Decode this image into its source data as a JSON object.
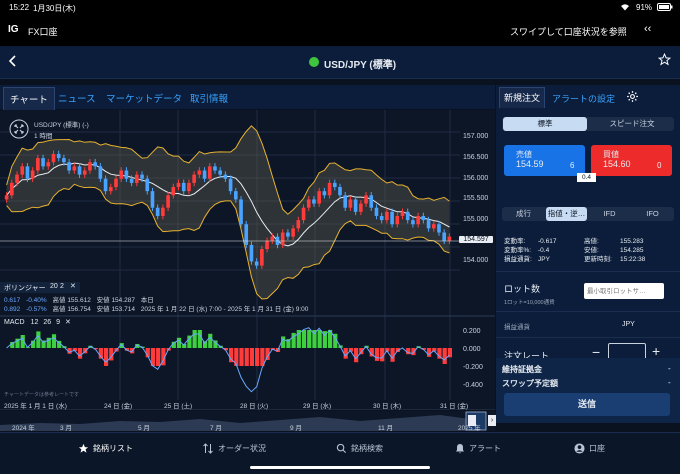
{
  "status": {
    "time": "15:22",
    "date": "1月30日(木)",
    "battery": "91%"
  },
  "header": {
    "logo": "IG",
    "account": "FX口座",
    "swipe_hint": "スワイプして口座状況を参照",
    "chevrons": "‹‹"
  },
  "pair": {
    "name": "USD/JPY (標準)",
    "dot_color": "#3ec43e"
  },
  "tabs": [
    "チャート",
    "ニュース",
    "マーケットデータ",
    "取引情報"
  ],
  "chart": {
    "symbol": "USD/JPY (標準) (-)",
    "timeframe": "1 時間",
    "current_price": "154.597",
    "y_ticks": [
      "157.000",
      "156.500",
      "156.000",
      "155.500",
      "155.000",
      "154.500",
      "154.000"
    ],
    "bollinger": {
      "label": "ボリンジャー",
      "period": "20",
      "dev": "2",
      "row1": {
        "c1": "0.617",
        "c2": "-0.40%",
        "c3": "高値 155.612",
        "c4": "安値 154.287",
        "c5": "本日"
      },
      "row2": {
        "c1": "0.892",
        "c2": "-0.57%",
        "c3": "高値 156.754",
        "c4": "安値 153.714",
        "c5": "2025 年 1 月 22 日 (水) 7:00 - 2025 年 1 月 31 日 (金) 9:00"
      }
    },
    "macd": {
      "label": "MACD",
      "p1": "12",
      "p2": "26",
      "p3": "9"
    },
    "macd_ticks": [
      "0.200",
      "0.000",
      "-0.200",
      "-0.400"
    ],
    "chart_note": "チャートデータは参考レートです",
    "date_label": "2025 年 1 月 1 日 (水)",
    "x_labels": [
      "24 日 (金)",
      "25 日 (土)",
      "28 日 (火)",
      "29 日 (水)",
      "30 日 (木)",
      "31 日 (金)"
    ],
    "overview_labels": [
      "2024 年",
      "3 月",
      "5 月",
      "7 月",
      "9 月",
      "11 月",
      "2025 年"
    ]
  },
  "order": {
    "tabs": [
      "新規注文",
      "アラートの設定"
    ],
    "modes": [
      "標準",
      "スピード注文"
    ],
    "sell_label": "売値",
    "sell_price_main": "154.59",
    "sell_price_small": "6",
    "buy_label": "買値",
    "buy_price_main": "154.60",
    "buy_price_small": "0",
    "spread": "0.4",
    "order_types": [
      "成行",
      "指値・逆…",
      "IFD",
      "IFO"
    ],
    "stats": [
      {
        "k": "変動率:",
        "v": "-0.617",
        "k2": "高値:",
        "v2": "155.283"
      },
      {
        "k": "変動率%:",
        "v": "-0.4",
        "k2": "安値:",
        "v2": "154.285"
      },
      {
        "k": "損益通貨:",
        "v": "JPY",
        "k2": "更新時刻:",
        "v2": "15:22:38"
      }
    ],
    "lot_label": "ロット数",
    "lot_note": "1ロット=10,000通貨",
    "lot_placeholder": "最小取引ロットサ…",
    "currency_label": "損益通貨",
    "currency_value": "JPY",
    "rate_label": "注文レート",
    "margin_label": "維持証拠金",
    "margin_value": "-",
    "swap_label": "スワップ予定額",
    "swap_value": "-",
    "submit": "送信"
  },
  "tabbar": [
    "銘柄リスト",
    "オーダー状況",
    "銘柄検索",
    "アラート",
    "口座"
  ],
  "chart_data": {
    "type": "line",
    "title": "USD/JPY (標準)",
    "ylim": [
      153.6,
      157.3
    ],
    "y_ticks": [
      157.0,
      156.5,
      156.0,
      155.5,
      155.0,
      154.5,
      154.0
    ],
    "close": [
      155.6,
      155.9,
      156.1,
      156.3,
      156.0,
      156.2,
      156.5,
      156.3,
      156.4,
      156.6,
      156.5,
      156.4,
      156.2,
      156.3,
      156.1,
      156.2,
      156.4,
      156.3,
      156.0,
      155.7,
      155.8,
      156.0,
      156.2,
      156.0,
      155.9,
      156.1,
      156.0,
      155.7,
      155.3,
      155.1,
      155.3,
      155.6,
      155.8,
      155.9,
      155.7,
      155.9,
      156.1,
      156.2,
      156.0,
      156.3,
      156.2,
      156.1,
      156.0,
      155.7,
      155.5,
      154.9,
      154.4,
      154.0,
      153.9,
      154.3,
      154.5,
      154.6,
      154.4,
      154.7,
      154.6,
      154.8,
      155.0,
      155.3,
      155.5,
      155.4,
      155.7,
      155.6,
      155.9,
      155.8,
      155.6,
      155.3,
      155.5,
      155.2,
      155.4,
      155.6,
      155.3,
      155.1,
      155.0,
      155.2,
      154.9,
      155.1,
      155.2,
      155.0,
      154.9,
      155.1,
      155.0,
      154.8,
      154.9,
      154.7,
      154.5,
      154.6
    ]
  }
}
